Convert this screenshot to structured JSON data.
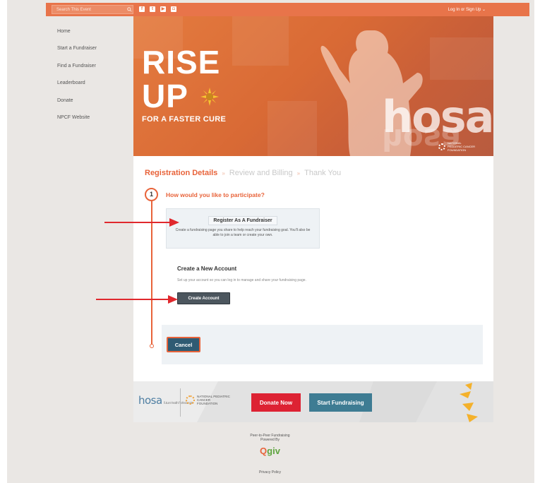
{
  "topbar": {
    "search_placeholder": "Search This Event",
    "social_icons": [
      "facebook-icon",
      "twitter-icon",
      "youtube-icon",
      "instagram-icon"
    ],
    "login_label": "Log In or Sign Up",
    "accent_color": "#e8744a"
  },
  "sidebar": {
    "items": [
      {
        "label": "Home"
      },
      {
        "label": "Start a Fundraiser"
      },
      {
        "label": "Find a Fundraiser"
      },
      {
        "label": "Leaderboard"
      },
      {
        "label": "Donate"
      },
      {
        "label": "NPCF Website"
      }
    ]
  },
  "hero": {
    "title_line1": "RISE",
    "title_line2": "UP",
    "tagline": "FOR A FASTER CURE",
    "watermark": "hosa",
    "partner_text": "NATIONAL PEDIATRIC CANCER FOUNDATION"
  },
  "steps": {
    "active": "Registration Details",
    "step2": "Review and Billing",
    "step3": "Thank You",
    "separator": "»"
  },
  "form": {
    "step_number": "1",
    "question": "How would you like to participate?",
    "register_button": "Register As A Fundraiser",
    "register_description": "Create a fundraising page you share to help reach your fundraising goal. You'll also be able to join a team or create your own.",
    "create_title": "Create a New Account",
    "create_description": "Set up your account so you can log in to manage and share your fundraising page.",
    "create_button": "Create Account",
    "cancel_button": "Cancel"
  },
  "band": {
    "hosa_logo": "hosa",
    "hosa_sub": "Future Health Professionals",
    "npcf_text": "NATIONAL PEDIATRIC CANCER FOUNDATION",
    "donate_button": "Donate Now",
    "fundraise_button": "Start Fundraising",
    "donate_color": "#dd2233",
    "fundraise_color": "#3e7c93"
  },
  "footer": {
    "p2p_line1": "Peer-to-Peer Fundraising",
    "p2p_line2": "Powered By",
    "brand_q": "Q",
    "brand_rest": "giv",
    "privacy": "Privacy Policy"
  }
}
